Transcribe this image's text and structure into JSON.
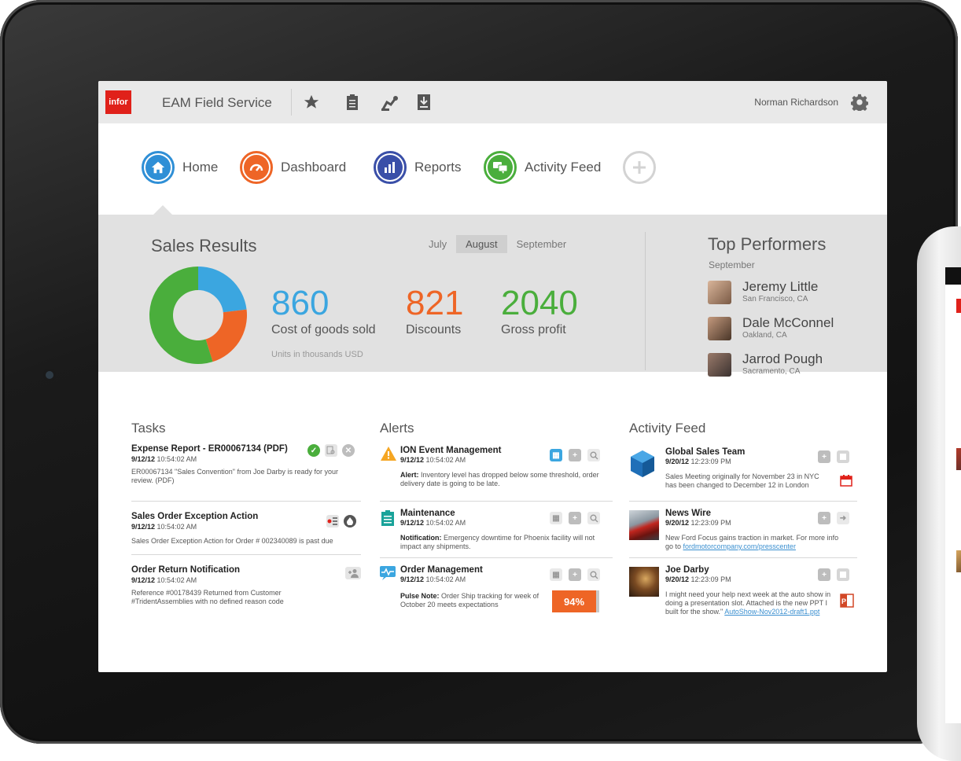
{
  "header": {
    "logo": "infor",
    "app_title": "EAM Field Service",
    "user_name": "Norman Richardson"
  },
  "nav": {
    "items": [
      {
        "label": "Home",
        "icon": "home-icon",
        "color": "#2f8fd6"
      },
      {
        "label": "Dashboard",
        "icon": "speedometer-icon",
        "color": "#ee6526"
      },
      {
        "label": "Reports",
        "icon": "bar-chart-icon",
        "color": "#3a4fa8"
      },
      {
        "label": "Activity Feed",
        "icon": "chat-bubbles-icon",
        "color": "#4aae3c"
      }
    ],
    "add_icon": "plus-icon"
  },
  "sales": {
    "title": "Sales Results",
    "months": [
      "July",
      "August",
      "September"
    ],
    "selected_month": "August",
    "metrics": [
      {
        "value": "860",
        "label": "Cost of goods sold",
        "color": "#3ba6e0"
      },
      {
        "value": "821",
        "label": "Discounts",
        "color": "#ee6526"
      },
      {
        "value": "2040",
        "label": "Gross profit",
        "color": "#4aae3c"
      }
    ],
    "units_note": "Units in thousands USD",
    "donut": [
      {
        "label": "Cost of goods sold",
        "value": 860,
        "color": "#3ba6e0"
      },
      {
        "label": "Discounts",
        "value": 821,
        "color": "#ee6526"
      },
      {
        "label": "Gross profit",
        "value": 2040,
        "color": "#4aae3c"
      }
    ]
  },
  "top_performers": {
    "title": "Top Performers",
    "subtitle": "September",
    "people": [
      {
        "name": "Jeremy Little",
        "location": "San Francisco, CA"
      },
      {
        "name": "Dale McConnel",
        "location": "Oakland, CA"
      },
      {
        "name": "Jarrod Pough",
        "location": "Sacramento, CA"
      }
    ]
  },
  "tasks": {
    "title": "Tasks",
    "items": [
      {
        "title": "Expense Report - ER00067134 (PDF)",
        "date": "9/12/12",
        "time": "10:54:02 AM",
        "desc": "ER00067134 \"Sales Convention\" from Joe Darby is ready for your review. (PDF)"
      },
      {
        "title": "Sales Order Exception Action",
        "date": "9/12/12",
        "time": "10:54:02 AM",
        "desc": "Sales Order Exception Action for Order # 002340089 is past due"
      },
      {
        "title": "Order Return Notification",
        "date": "9/12/12",
        "time": "10:54:02 AM",
        "desc": "Reference #00178439 Returned from Customer #TridentAssemblies with no defined reason code"
      }
    ]
  },
  "alerts": {
    "title": "Alerts",
    "items": [
      {
        "title": "ION Event Management",
        "date": "9/12/12",
        "time": "10:54:02 AM",
        "lead": "Alert:",
        "desc": "Inventory level has dropped below some threshold, order delivery date is going to be late."
      },
      {
        "title": "Maintenance",
        "date": "9/12/12",
        "time": "10:54:02 AM",
        "lead": "Notification:",
        "desc": "Emergency downtime for Phoenix facility will not impact any shipments."
      },
      {
        "title": "Order Management",
        "date": "9/12/12",
        "time": "10:54:02 AM",
        "lead": "Pulse Note:",
        "desc": "Order Ship tracking for week of October 20 meets expectations",
        "percent": "94%"
      }
    ]
  },
  "activity": {
    "title": "Activity Feed",
    "items": [
      {
        "title": "Global Sales Team",
        "date": "9/20/12",
        "time": "12:23:09 PM",
        "desc": "Sales Meeting originally for November 23 in NYC has been changed to December 12 in London"
      },
      {
        "title": "News Wire",
        "date": "9/20/12",
        "time": "12:23:09 PM",
        "desc": "New Ford Focus gains traction in market. For more info go to",
        "link": "fordmotorcompany.com/presscenter"
      },
      {
        "title": "Joe Darby",
        "date": "9/20/12",
        "time": "12:23:09 PM",
        "desc": "I might need your help next week at the auto show in doing a presentation slot. Attached is the new PPT I built for the show.\"",
        "link": "AutoShow-Nov2012-draft1.ppt"
      }
    ]
  }
}
